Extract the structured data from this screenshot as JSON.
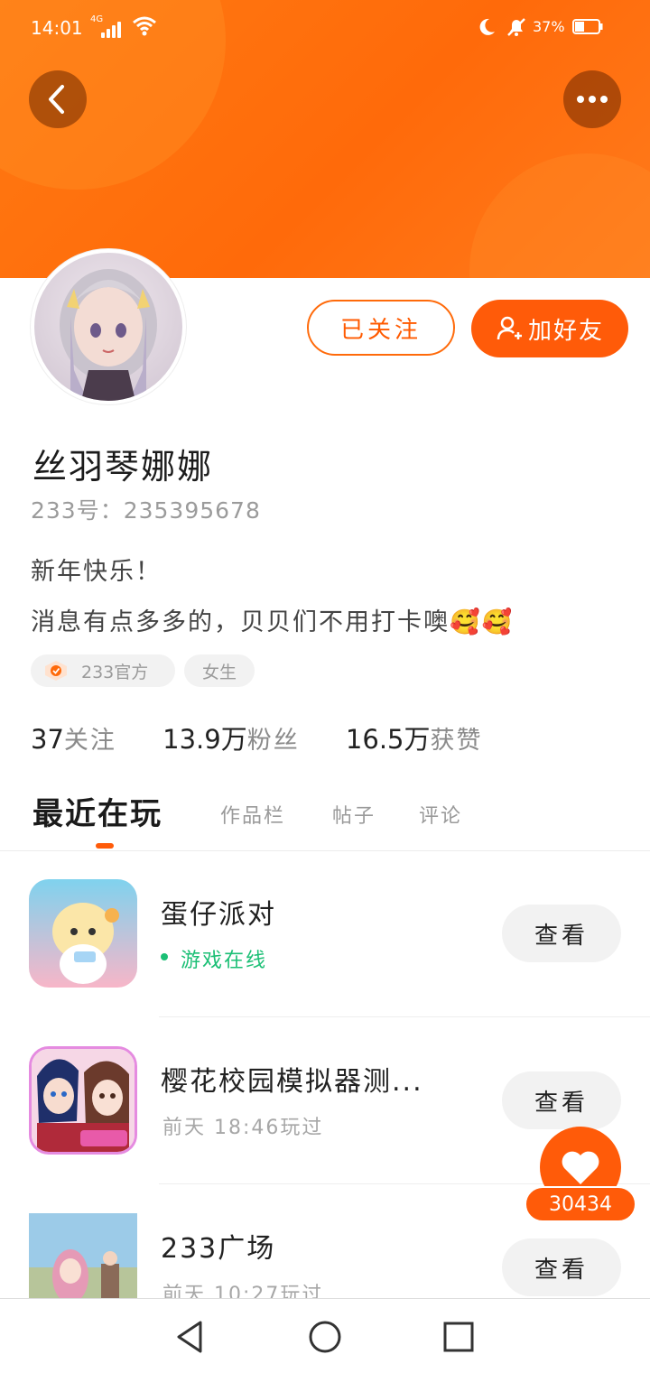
{
  "status_bar": {
    "time": "14:01",
    "network": "4G",
    "battery": "37%"
  },
  "header": {
    "back_icon": "chevron-left-icon",
    "more_icon": "more-dots-icon"
  },
  "profile": {
    "follow_button": "已关注",
    "add_friend_button": "加好友",
    "name": "丝羽琴娜娜",
    "uid": "233号：235395678",
    "bio_line1": "新年快乐！",
    "bio_line2": "消息有点多多的，贝贝们不用打卡噢🥰🥰",
    "tags": [
      "233官方",
      "女生"
    ],
    "stats": [
      {
        "value": "37",
        "label": "关注"
      },
      {
        "value": "13.9万",
        "label": "粉丝"
      },
      {
        "value": "16.5万",
        "label": "获赞"
      }
    ]
  },
  "tabs": [
    {
      "label": "最近在玩",
      "active": true
    },
    {
      "label": "作品栏",
      "active": false
    },
    {
      "label": "帖子",
      "active": false
    },
    {
      "label": "评论",
      "active": false
    }
  ],
  "games": [
    {
      "title": "蛋仔派对",
      "subtitle": "游戏在线",
      "online": true,
      "button": "查看"
    },
    {
      "title": "樱花校园模拟器测...",
      "subtitle": "前天 18:46玩过",
      "online": false,
      "button": "查看"
    },
    {
      "title": "233广场",
      "subtitle": "前天 10:27玩过",
      "online": false,
      "button": "查看"
    }
  ],
  "like_count": "30434",
  "colors": {
    "accent": "#ff5b09",
    "online_green": "#1bbf75"
  }
}
